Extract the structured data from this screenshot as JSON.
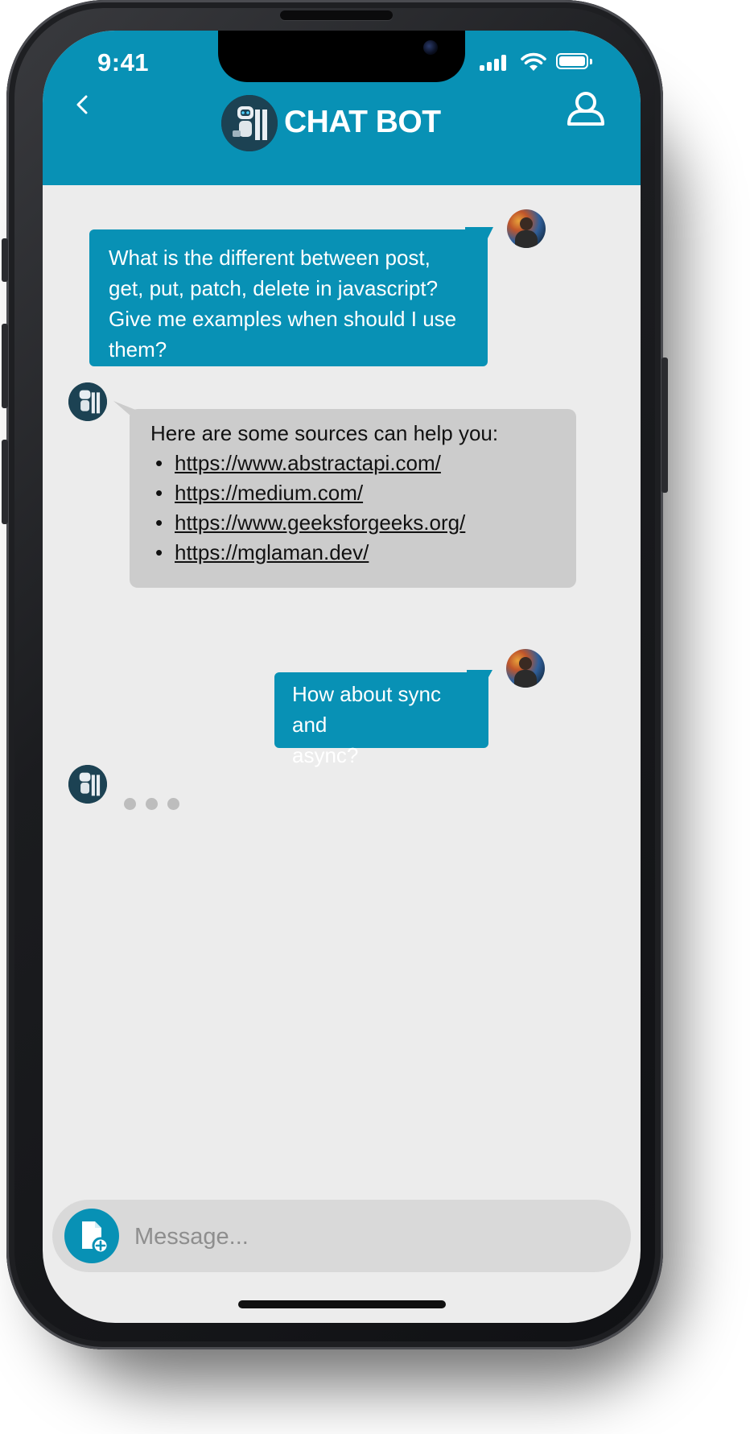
{
  "status_bar": {
    "time": "9:41"
  },
  "header": {
    "title": "CHAT BOT"
  },
  "icons": {
    "back": "chevron-left-icon",
    "profile": "user-icon",
    "attach": "file-add-icon",
    "bot_avatar": "robot-icon",
    "user_avatar": "user-avatar"
  },
  "messages": [
    {
      "sender": "user",
      "lines": [
        "What is the different between post,",
        "get, put, patch, delete in javascript?",
        "Give me examples when should I use",
        "them?"
      ]
    },
    {
      "sender": "bot",
      "intro": "Here are some sources can help you:",
      "links": [
        "https://www.abstractapi.com/",
        "https://medium.com/",
        "https://www.geeksforgeeks.org/",
        "https://mglaman.dev/"
      ]
    },
    {
      "sender": "user",
      "lines": [
        "How about sync and",
        "async?"
      ]
    }
  ],
  "composer": {
    "placeholder": "Message..."
  },
  "colors": {
    "accent": "#0891b5",
    "bot_bubble": "#cccccc",
    "chat_background": "#ececec",
    "composer_background": "#d9d9d9"
  }
}
